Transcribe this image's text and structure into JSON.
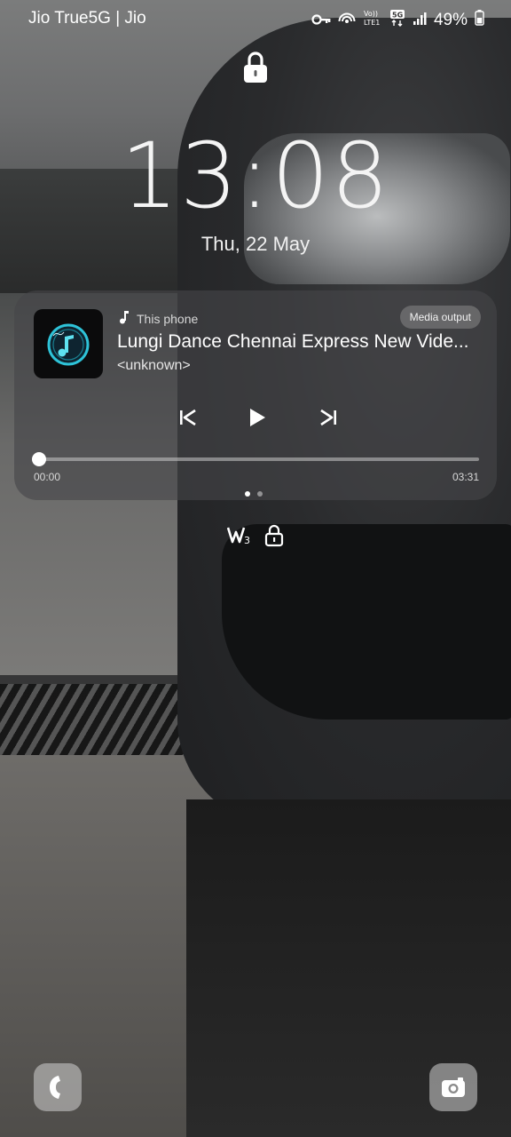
{
  "status_bar": {
    "carrier": "Jio True5G | Jio",
    "volte_label": "Vo))\nLTE1",
    "network_label": "5G",
    "battery_percent": "49%",
    "icons": [
      "key-icon",
      "hotspot-icon",
      "volte-icon",
      "5g-icon",
      "signal-icon",
      "battery-icon"
    ]
  },
  "lock_screen": {
    "time": "13:08",
    "date": "Thu, 22 May"
  },
  "media": {
    "source_label": "This phone",
    "output_button": "Media output",
    "title": "Lungi Dance Chennai Express New Vide...",
    "artist": "<unknown>",
    "elapsed": "00:00",
    "duration": "03:31",
    "progress_fraction": 0.0
  },
  "widgets": {
    "icons": [
      "wellbeing-icon",
      "lock-icon"
    ]
  },
  "shortcuts": {
    "left": "phone-icon",
    "right": "camera-icon"
  }
}
